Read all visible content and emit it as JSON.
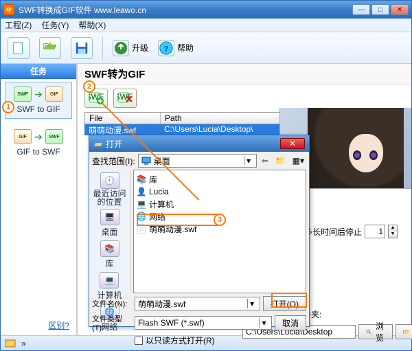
{
  "window": {
    "title": "SWF转换成GIF软件 www.leawo.cn",
    "min": "—",
    "max": "□",
    "close": "✕"
  },
  "menu": {
    "project": "工程(Z)",
    "task": "任务(Y)",
    "help": "帮助(X)"
  },
  "toolbar": {
    "upgrade": "升级",
    "help": "帮助"
  },
  "side": {
    "header": "任务",
    "swf2gif": "SWF to GIF",
    "gif2swf": "GIF to SWF",
    "diff": "区别?"
  },
  "main": {
    "title": "SWF转为GIF",
    "cols": {
      "file": "File",
      "path": "Path"
    },
    "rows": [
      {
        "file": "萌萌动漫.swf",
        "path": "C:\\Users\\Lucia\\Desktop\\"
      }
    ]
  },
  "stop": {
    "label": "多长时间后停止",
    "value": "1"
  },
  "save": {
    "label": "保存到其他文件夹:",
    "path": "C:\\Users\\Lucia\\Desktop",
    "browse": "浏览",
    "open": "打开"
  },
  "dlg": {
    "title": "打开",
    "lookin_lbl": "查找范围(I):",
    "lookin_val": "桌面",
    "places": {
      "recent": "最近访问的位置",
      "desktop": "桌面",
      "libs": "库",
      "computer": "计算机",
      "network": "网络"
    },
    "items": {
      "libs": "库",
      "lucia": "Lucia",
      "computer": "计算机",
      "network": "网络",
      "swf": "萌萌动漫.swf"
    },
    "fname_lbl": "文件名(N):",
    "fname_val": "萌萌动漫.swf",
    "ftype_lbl": "文件类型(T):",
    "ftype_val": "Flash SWF (*.swf)",
    "readonly": "以只读方式打开(R)",
    "open": "打开(O)",
    "cancel": "取消"
  },
  "markers": {
    "m1": "1",
    "m2": "2",
    "m3": "3"
  }
}
